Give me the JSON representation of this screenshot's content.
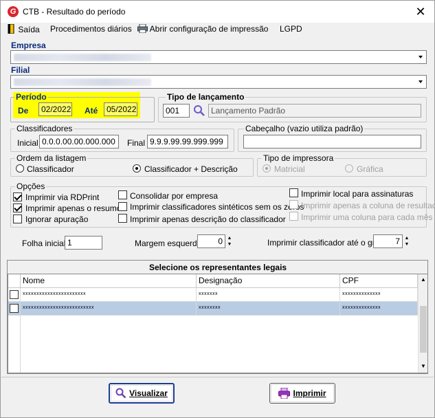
{
  "window": {
    "title": "CTB - Resultado do período",
    "close_glyph": "✕"
  },
  "menu": {
    "saida": "Saída",
    "procedimentos": "Procedimentos diários",
    "configuracao": "Abrir configuração de impressão",
    "lgpd": "LGPD"
  },
  "empresa": {
    "label": "Empresa"
  },
  "filial": {
    "label": "Filial"
  },
  "periodo": {
    "label": "Período",
    "de_label": "De",
    "de_value": "02/2022",
    "ate_label": "Até",
    "ate_value": "05/2022"
  },
  "tipo_lancamento": {
    "label": "Tipo de lançamento",
    "code": "001",
    "description": "Lançamento Padrão"
  },
  "classificadores": {
    "label": "Classificadores",
    "inicial_label": "Inicial",
    "inicial_value": "0.0.0.00.00.000.000",
    "final_label": "Final",
    "final_value": "9.9.9.99.99.999.999"
  },
  "cabecalho": {
    "label": "Cabeçalho (vazio utiliza padrão)",
    "value": ""
  },
  "ordem": {
    "label": "Ordem da listagem",
    "opt1": "Classificador",
    "opt2": "Classificador + Descrição",
    "selected": "Classificador + Descrição"
  },
  "impressora": {
    "label": "Tipo de impressora",
    "opt1": "Matricial",
    "opt2": "Gráfica",
    "selected": "Matricial"
  },
  "opcoes": {
    "label": "Opções",
    "items": [
      {
        "label": "Imprimir via RDPrint",
        "checked": true,
        "enabled": true
      },
      {
        "label": "Imprimir apenas o resumo",
        "checked": true,
        "enabled": true
      },
      {
        "label": "Ignorar apuração",
        "checked": false,
        "enabled": true
      },
      {
        "label": "Consolidar por empresa",
        "checked": false,
        "enabled": true
      },
      {
        "label": "Imprimir classificadores sintéticos sem os zeros",
        "checked": false,
        "enabled": true
      },
      {
        "label": "Imprimir apenas descrição do classificador",
        "checked": false,
        "enabled": true
      },
      {
        "label": "Imprimir local para assinaturas",
        "checked": false,
        "enabled": true
      },
      {
        "label": "Imprimir apenas a coluna de resultado",
        "checked": false,
        "enabled": false
      },
      {
        "label": "Imprimir uma coluna para cada mês",
        "checked": false,
        "enabled": false
      }
    ]
  },
  "folha": {
    "label": "Folha inicial",
    "value": "1"
  },
  "margem": {
    "label": "Margem esquerda",
    "value": "0"
  },
  "grau": {
    "label": "Imprimir classificador até o grau",
    "value": "7"
  },
  "representantes": {
    "title": "Selecione os representantes legais",
    "columns": [
      "Nome",
      "Designação",
      "CPF"
    ],
    "rows": [
      {
        "nome": "xxxxxxxxxxxxxxxxxxxxxxx",
        "designacao": "xxxxxxx",
        "cpf": "xxxxxxxxxxxxxx"
      },
      {
        "nome": "xxxxxxxxxxxxxxxxxxxxxxxxxx",
        "designacao": "xxxxxxxx",
        "cpf": "xxxxxxxxxxxxxx"
      }
    ]
  },
  "buttons": {
    "visualizar": "Visualizar",
    "imprimir": "Imprimir"
  },
  "colors": {
    "highlight_yellow": "#ffff00",
    "selected_row": "#b8cce4",
    "label_blue": "#0a2a7a"
  }
}
